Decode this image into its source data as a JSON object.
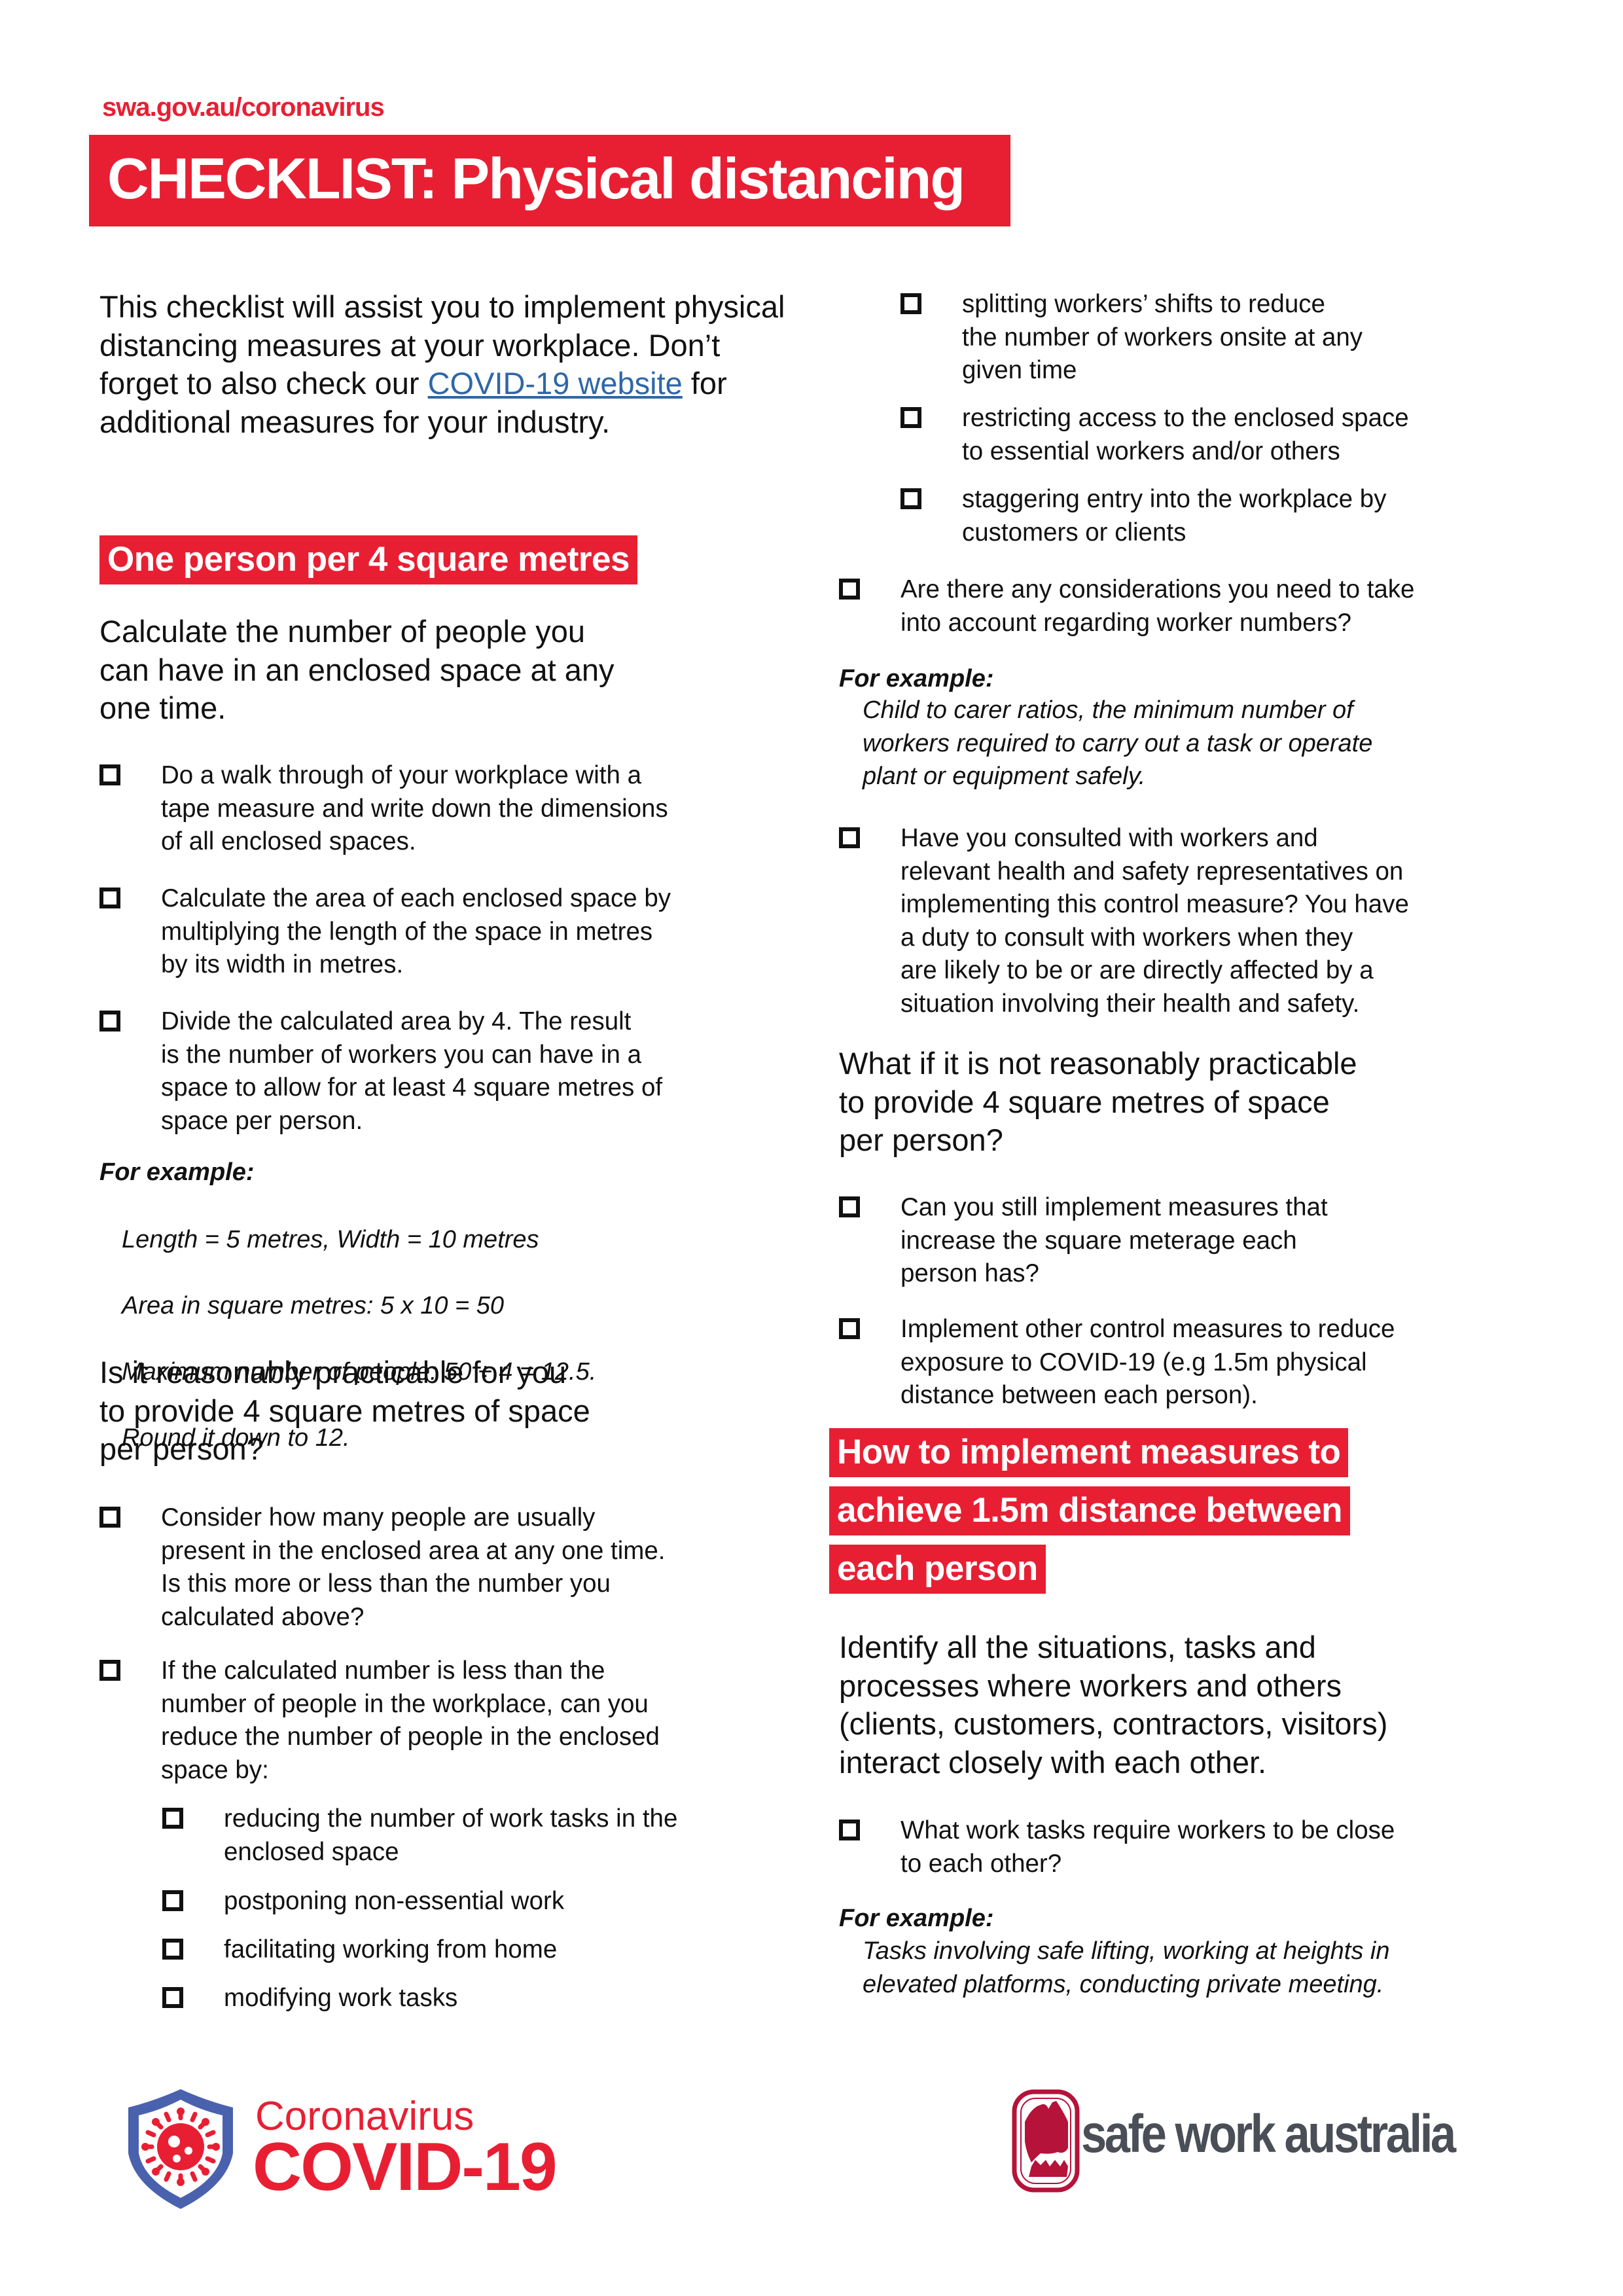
{
  "header": {
    "url": "swa.gov.au/coronavirus",
    "title": "CHECKLIST: Physical distancing"
  },
  "intro": {
    "text_before_link": "This checklist will assist you to implement physical distancing measures at your workplace. Don’t forget to also check our ",
    "link_text": "COVID-19 website",
    "text_after_link": " for additional measures for your industry."
  },
  "section1": {
    "heading": "One person per 4 square metres",
    "subheading": "Calculate the number of people you\ncan have in an enclosed space at any\none time.",
    "items": [
      "Do a walk through of your workplace with a\ntape measure and write down the dimensions\nof all enclosed spaces.",
      "Calculate the area of each enclosed space by\nmultiplying the length of the space in metres\nby its width in metres.",
      "Divide the calculated area by 4. The result\nis the number of workers you can have in a\nspace to allow for at least 4 square metres of\nspace per person."
    ],
    "example_label": "For example:",
    "example_lines": [
      "Length = 5 metres, Width = 10 metres",
      "Area in square metres: 5 x 10 = 50",
      "Maximum number of people: 50 ÷ 4 = 12.5.",
      "Round it down to 12."
    ],
    "question": "Is it reasonably practicable for you\nto provide 4 square metres of space\nper person?",
    "question_items": [
      "Consider how many people are usually\npresent in the enclosed area at any one time.\nIs this more or less than the number you\ncalculated above?",
      "If the calculated number is less than the\nnumber of people in the workplace, can you\nreduce the number of people in the enclosed\nspace by:"
    ],
    "sub_items": [
      "reducing the number of work tasks in the\nenclosed space",
      "postponing non-essential work",
      "facilitating working from home",
      "modifying work tasks",
      "splitting workers’ shifts to reduce\nthe number of workers onsite at any\ngiven time",
      "restricting access to the enclosed space\nto essential workers and/or others",
      "staggering entry into the workplace by\ncustomers or clients"
    ],
    "considerations_item": "Are there any considerations you need to take\ninto account regarding worker numbers?",
    "example2_label": "For example:",
    "example2_text": "Child to carer ratios, the minimum number of\nworkers required to carry out a task or operate\nplant or equipment safely.",
    "consult_item": "Have you consulted with workers and\nrelevant health and safety representatives on\nimplementing this control measure? You have\na duty to consult with workers when they\nare likely to be or are directly affected by a\nsituation involving their health and safety."
  },
  "section2": {
    "question": "What if it is not reasonably practicable\nto provide 4 square metres of space\nper person?",
    "items": [
      "Can you still implement measures that\nincrease the square meterage each\nperson has?",
      "Implement other control measures to reduce\nexposure to COVID-19 (e.g 1.5m physical\ndistance between each person)."
    ]
  },
  "section3": {
    "heading_lines": [
      "How to implement measures to",
      "achieve 1.5m distance between",
      "each person"
    ],
    "intro": "Identify all the situations, tasks and\nprocesses where workers and others\n(clients, customers, contractors, visitors)\ninteract closely with each other.",
    "items": [
      "What work tasks require workers to be close\nto each other?"
    ],
    "example_label": "For example:",
    "example_text": "Tasks involving safe lifting, working at heights in\nelevated platforms, conducting private meeting."
  },
  "footer": {
    "covid_logo_small": "Coronavirus",
    "covid_logo_large": "COVID-19",
    "swa_logo_text": "safe work australia",
    "icons": [
      "shield-virus-icon",
      "australia-map-icon"
    ]
  },
  "colors": {
    "brand_red": "#e81f33",
    "link_blue": "#2e67a8",
    "shield_blue": "#4a62ad",
    "swa_maroon": "#b5133a",
    "swa_grey": "#4a4f57"
  }
}
